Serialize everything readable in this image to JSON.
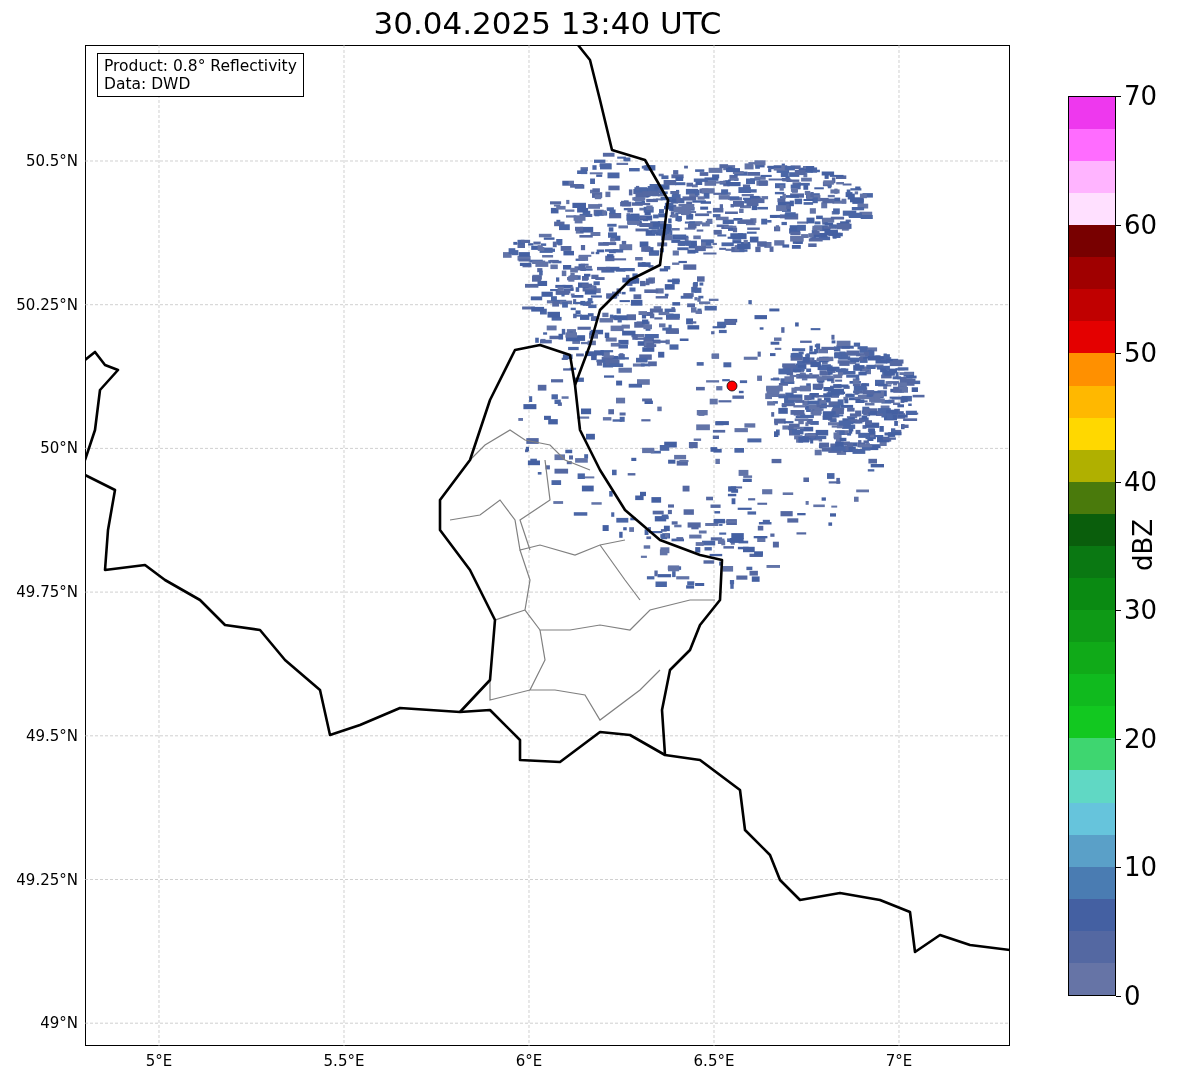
{
  "title": "30.04.2025 13:40 UTC",
  "info_box": {
    "lines": [
      "Product: 0.8° Reflectivity",
      "Data: DWD"
    ]
  },
  "y_axis": {
    "ticks": [
      "50.5°N",
      "50.25°N",
      "50°N",
      "49.75°N",
      "49.5°N",
      "49.25°N",
      "49°N"
    ]
  },
  "x_axis": {
    "ticks": [
      "5°E",
      "5.5°E",
      "6°E",
      "6.5°E",
      "7°E"
    ]
  },
  "colorbar": {
    "label": "dBZ",
    "ticks": [
      "70",
      "60",
      "50",
      "40",
      "30",
      "20",
      "10",
      "0"
    ],
    "segments": [
      {
        "color": "#6674a6"
      },
      {
        "color": "#5468a2"
      },
      {
        "color": "#4460a2"
      },
      {
        "color": "#4a7cb2"
      },
      {
        "color": "#5aa0c8"
      },
      {
        "color": "#66c4dc"
      },
      {
        "color": "#60d8c4"
      },
      {
        "color": "#3ed670"
      },
      {
        "color": "#12c820"
      },
      {
        "color": "#10ba1e"
      },
      {
        "color": "#10aa18"
      },
      {
        "color": "#0e9a16"
      },
      {
        "color": "#0a8a12"
      },
      {
        "color": "#0a7812"
      },
      {
        "color": "#0a5e0c"
      },
      {
        "color": "#4a7a0c"
      },
      {
        "color": "#b0b000"
      },
      {
        "color": "#ffd800"
      },
      {
        "color": "#ffb800"
      },
      {
        "color": "#ff9000"
      },
      {
        "color": "#e40000"
      },
      {
        "color": "#c00000"
      },
      {
        "color": "#a00000"
      },
      {
        "color": "#780000"
      },
      {
        "color": "#ffe0ff"
      },
      {
        "color": "#ffb4ff"
      },
      {
        "color": "#ff6cff"
      },
      {
        "color": "#ee38ee"
      }
    ]
  }
}
